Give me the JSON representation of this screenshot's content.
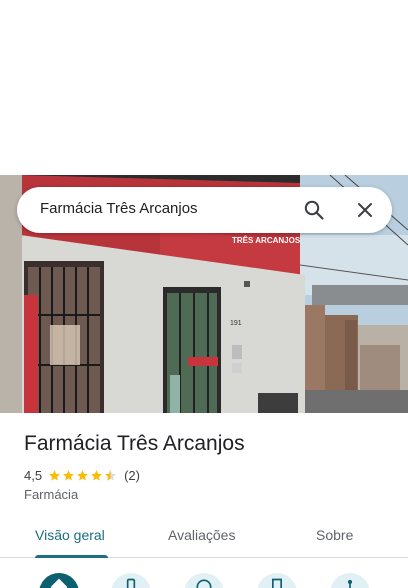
{
  "search": {
    "query": "Farmácia Três Arcanjos"
  },
  "place": {
    "name": "Farmácia Três Arcanjos",
    "rating": "4,5",
    "rating_stars": 4.5,
    "review_count": "(2)",
    "category": "Farmácia"
  },
  "photo": {
    "storefront_sign": "TRÊS ARCANJOS",
    "house_number": "191"
  },
  "tabs": [
    {
      "label": "Visão geral",
      "active": true
    },
    {
      "label": "Avaliações",
      "active": false
    },
    {
      "label": "Sobre",
      "active": false
    }
  ],
  "actions": [
    {
      "icon": "directions-icon",
      "primary": true
    },
    {
      "icon": "phone-icon",
      "primary": false
    },
    {
      "icon": "website-icon",
      "primary": false
    },
    {
      "icon": "save-icon",
      "primary": false
    },
    {
      "icon": "share-icon",
      "primary": false
    }
  ],
  "colors": {
    "accent": "#1b6f80",
    "star": "#fbbc04",
    "primary_action": "#0d6070",
    "secondary_action": "#e1f0f5"
  }
}
